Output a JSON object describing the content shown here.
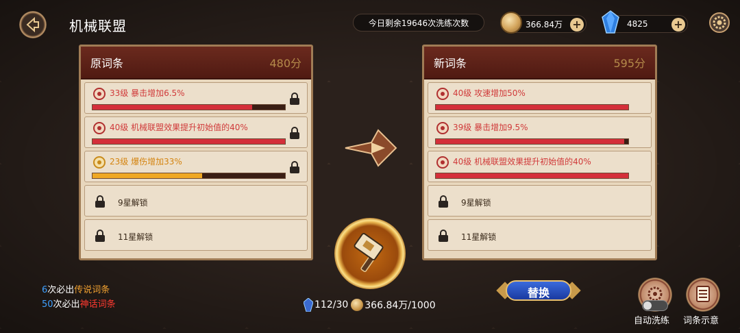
{
  "header": {
    "title": "机械联盟",
    "wash_remaining": "今日剩余19646次洗练次数",
    "gold": "366.84万",
    "gems": "4825"
  },
  "left_panel": {
    "title": "原词条",
    "score": "480分",
    "rows": [
      {
        "text": "33级 暴击增加6.5%",
        "progress": 0.83
      },
      {
        "text": "40级 机械联盟效果提升初始值的40%",
        "progress": 1.0
      },
      {
        "text": "23级 爆伤增加33%",
        "progress": 0.57
      }
    ],
    "locked": [
      "9星解锁",
      "11星解锁"
    ]
  },
  "right_panel": {
    "title": "新词条",
    "score": "595分",
    "rows": [
      {
        "text": "40级 攻速增加50%",
        "progress": 1.0
      },
      {
        "text": "39级 暴击增加9.5%",
        "progress": 0.98
      },
      {
        "text": "40级 机械联盟效果提升初始值的40%",
        "progress": 1.0
      }
    ],
    "locked": [
      "9星解锁",
      "11星解锁"
    ]
  },
  "guarantee": {
    "legend_count": "6",
    "legend_mid": "次必出",
    "legend_label": "传说词条",
    "myth_count": "50",
    "myth_mid": "次必出",
    "myth_label": "神话词条"
  },
  "cost": {
    "gems": "112/30",
    "gold": "366.84万/1000"
  },
  "buttons": {
    "replace": "替换",
    "auto_wash": "自动洗练",
    "hint": "词条示意"
  },
  "colors": {
    "red_fill": "#d42f3a",
    "gold_fill": "#efa824",
    "panel_bg": "#e8d7bd"
  }
}
